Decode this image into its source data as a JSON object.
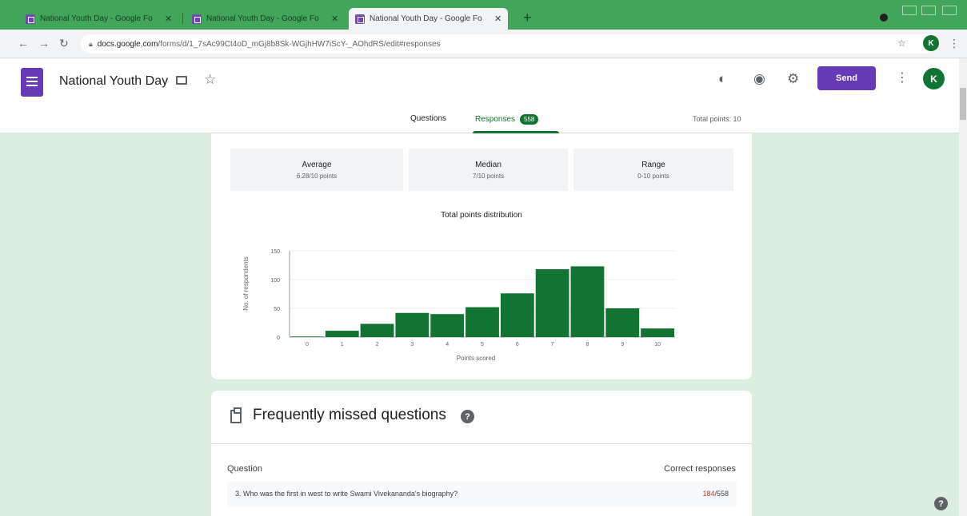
{
  "browser": {
    "tabs": [
      {
        "title": "National Youth Day - Google Fo",
        "close": "✕"
      },
      {
        "title": "National Youth Day - Google Fo",
        "close": "✕"
      },
      {
        "title": "National Youth Day - Google Fo",
        "close": "✕"
      }
    ],
    "new_tab": "+",
    "url_host": "docs.google.com",
    "url_path": "/forms/d/1_7sAc99Ct4oD_mGj8b8Sk-WGjhHW7iScY-_AOhdRS/edit#responses"
  },
  "header": {
    "form_title": "National Youth Day",
    "send_label": "Send",
    "account_initial": "K",
    "tabs": {
      "questions": "Questions",
      "responses": "Responses",
      "responses_count": "558"
    },
    "total_points": "Total points: 10"
  },
  "summary": {
    "average": {
      "label": "Average",
      "value": "6.28/10 points"
    },
    "median": {
      "label": "Median",
      "value": "7/10 points"
    },
    "range": {
      "label": "Range",
      "value": "0-10 points"
    }
  },
  "chart_data": {
    "type": "bar",
    "title": "Total points distribution",
    "xlabel": "Points scored",
    "ylabel": "No. of respondents",
    "categories": [
      "0",
      "1",
      "2",
      "3",
      "4",
      "5",
      "6",
      "7",
      "8",
      "9",
      "10"
    ],
    "values": [
      1,
      11,
      23,
      42,
      40,
      52,
      76,
      118,
      123,
      50,
      15
    ],
    "ylim": [
      0,
      150
    ],
    "yticks": [
      "0",
      "50",
      "100",
      "150"
    ],
    "bar_color": "#137333",
    "grid": true
  },
  "missed": {
    "title": "Frequently missed questions",
    "col_question": "Question",
    "col_correct": "Correct responses",
    "rows": [
      {
        "question": "3. Who was the first in west to write Swami Vivekananda's biography?",
        "correct": "184",
        "total": "/558"
      }
    ]
  },
  "colors": {
    "brand_purple": "#673ab7",
    "accent_green": "#137333",
    "page_bg": "#dbeedf"
  }
}
